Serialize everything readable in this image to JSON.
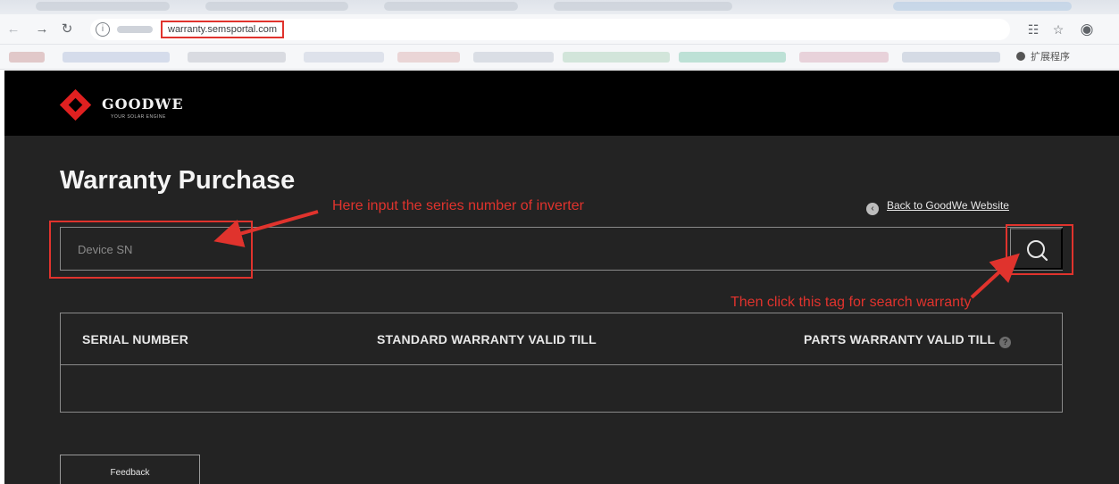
{
  "browser": {
    "url": "warranty.semsportal.com",
    "extension_label": "扩展程序"
  },
  "site": {
    "logo_word": "GOODWE",
    "logo_tagline": "YOUR SOLAR ENGINE",
    "page_title": "Warranty Purchase",
    "back_link": "Back to GoodWe Website",
    "search": {
      "placeholder": "Device SN",
      "value": ""
    },
    "table": {
      "headers": [
        "SERIAL NUMBER",
        "STANDARD WARRANTY VALID TILL",
        "PARTS WARRANTY VALID TILL"
      ],
      "rows": []
    },
    "feedback_label": "Feedback"
  },
  "annotations": {
    "input_hint": "Here input the series number of inverter",
    "search_hint": "Then click this tag for search warranty",
    "color": "#e0332d"
  },
  "colors": {
    "site_background": "#232323",
    "header_background": "#000000",
    "brand_red": "#e02020"
  }
}
